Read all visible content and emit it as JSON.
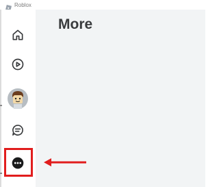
{
  "window": {
    "app_name": "Roblox",
    "icon": "roblox-logo-icon"
  },
  "main": {
    "title": "More"
  },
  "sidebar": {
    "items": [
      {
        "id": "home",
        "icon": "home-icon"
      },
      {
        "id": "discover",
        "icon": "play-circle-icon"
      },
      {
        "id": "avatar",
        "icon": "avatar-icon"
      },
      {
        "id": "chat",
        "icon": "chat-icon"
      },
      {
        "id": "more",
        "icon": "more-dots-icon",
        "selected": true
      }
    ]
  },
  "annotations": {
    "highlight_color": "#e11d1d",
    "arrow_color": "#e11d1d"
  },
  "colors": {
    "content_background": "#f2f4f5",
    "title_text": "#393b3d",
    "icon": "#393b3d"
  }
}
